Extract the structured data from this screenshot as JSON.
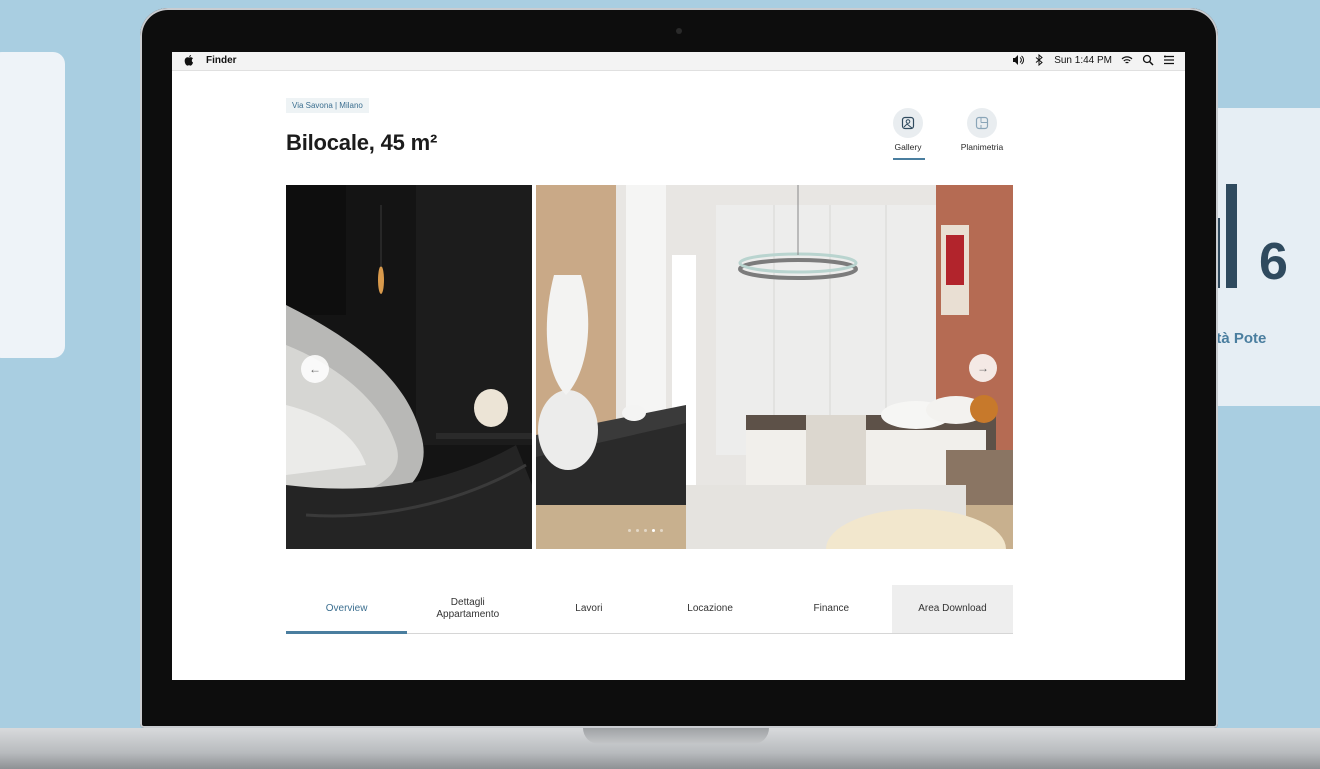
{
  "menubar": {
    "app_name": "Finder",
    "clock": "Sun 1:44 PM"
  },
  "listing": {
    "location": "Via Savona | Milano",
    "title": "Bilocale, 45 m²"
  },
  "view_switch": {
    "gallery_label": "Gallery",
    "plan_label": "Planimetria",
    "active": "Gallery"
  },
  "gallery": {
    "slide_count": 5,
    "active_slide": 4
  },
  "tabs": [
    {
      "label": "Overview",
      "active": true
    },
    {
      "label": "Dettagli\nAppartamento",
      "active": false
    },
    {
      "label": "Lavori",
      "active": false
    },
    {
      "label": "Locazione",
      "active": false
    },
    {
      "label": "Finance",
      "active": false
    },
    {
      "label": "Area Download",
      "active": false
    }
  ],
  "stat_card": {
    "value": "6",
    "caption": "Redditività Pote"
  },
  "colors": {
    "accent": "#4a7e9f",
    "background": "#a9cee1",
    "bars": "#2f4a5e"
  }
}
